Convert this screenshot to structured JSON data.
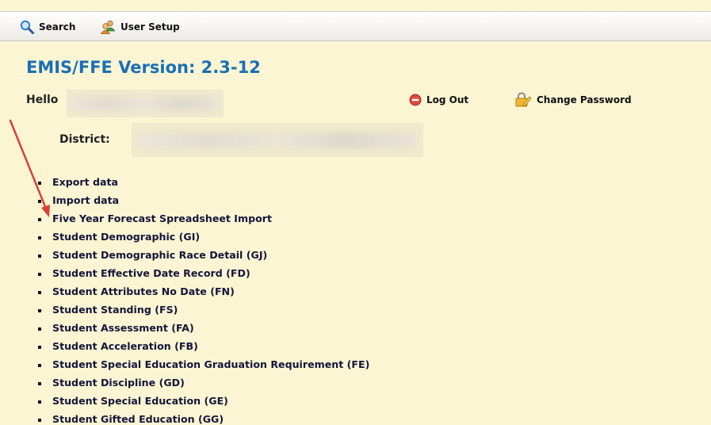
{
  "toolbar": {
    "search_label": "Search",
    "search_icon": "search-icon",
    "user_setup_label": "User Setup",
    "user_setup_icon": "users-icon"
  },
  "header": {
    "version_title": "EMIS/FFE Version: 2.3-12",
    "hello_label": "Hello",
    "logout_label": "Log Out",
    "change_password_label": "Change Password",
    "district_label": "District:"
  },
  "menu": {
    "items": [
      "Export data",
      "Import data",
      "Five Year Forecast Spreadsheet Import",
      "Student Demographic (GI)",
      "Student Demographic Race Detail (GJ)",
      "Student Effective Date Record (FD)",
      "Student Attributes No Date (FN)",
      "Student Standing (FS)",
      "Student Assessment (FA)",
      "Student Acceleration (FB)",
      "Student Special Education Graduation Requirement (FE)",
      "Student Discipline (GD)",
      "Student Special Education (GE)",
      "Student Gifted Education (GG)"
    ]
  },
  "colors": {
    "background": "#fbf5d3",
    "title_blue": "#1a6fb5",
    "arrow_red": "#d9403a",
    "logout_red": "#e04a3c"
  }
}
